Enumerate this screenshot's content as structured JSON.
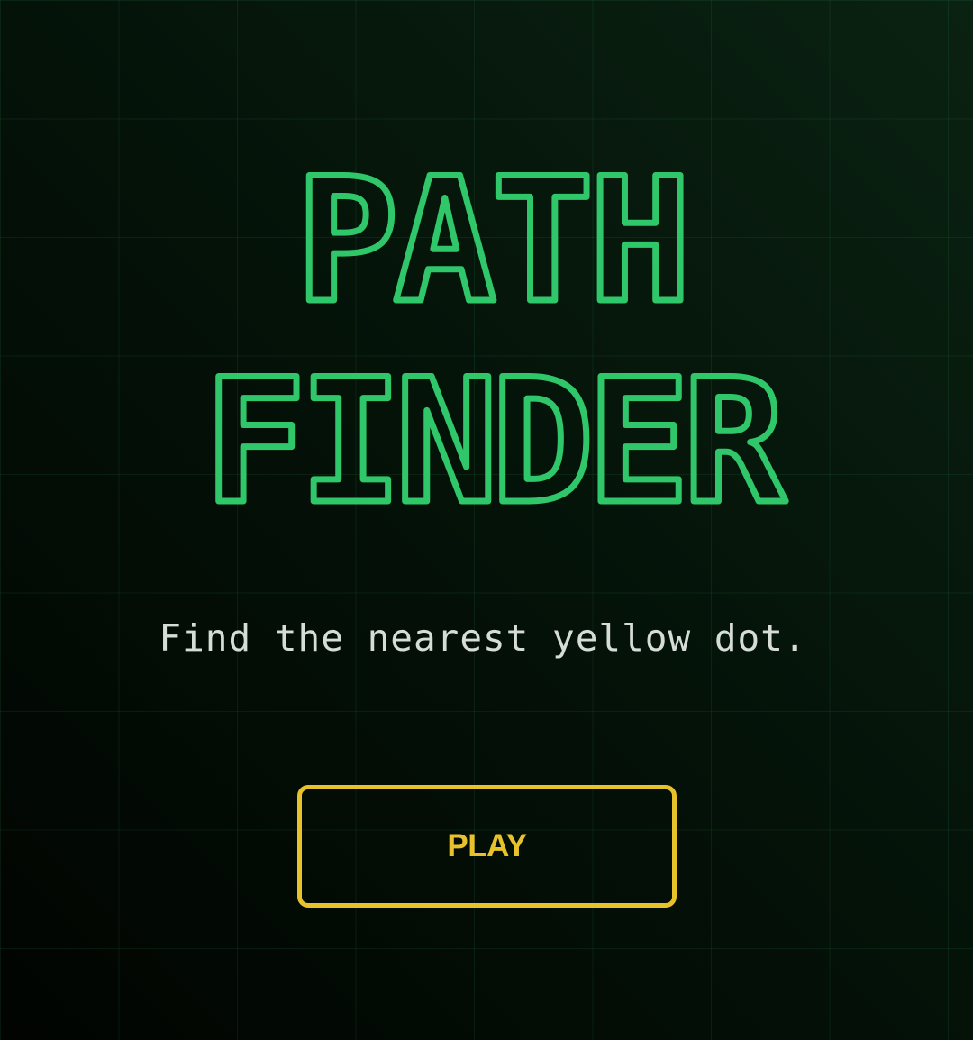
{
  "title": {
    "line1": "PATH",
    "line2": "FINDER"
  },
  "subtitle": "Find the nearest yellow dot.",
  "play_button": {
    "label": "PLAY"
  },
  "colors": {
    "title_outline": "#2fc76a",
    "accent_yellow": "#e8c22a",
    "subtitle_text": "#d6dcd6",
    "background_dark": "#010401",
    "background_green": "#0a2212"
  }
}
